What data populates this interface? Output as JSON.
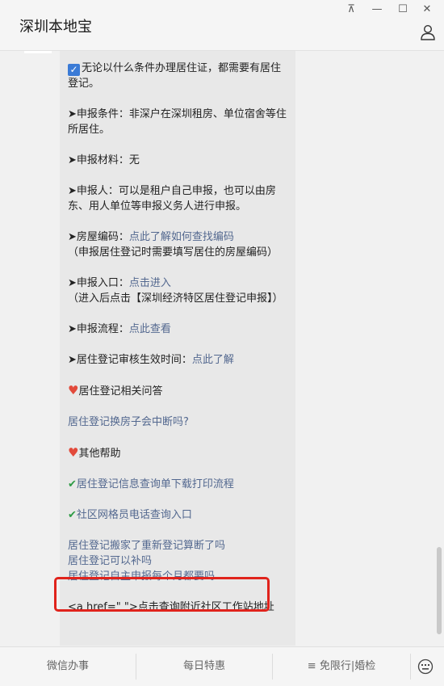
{
  "window": {
    "title": "深圳本地宝",
    "pin_glyph": "⊼",
    "minimize_glyph": "—",
    "maximize_glyph": "☐",
    "close_glyph": "✕"
  },
  "message": {
    "lines": [
      {
        "icon": "checkbox-icon",
        "text": "无论以什么条件办理居住证，都需要有居住登记。"
      },
      {
        "prefix": "➤申报条件：",
        "text": "非深户在深圳租房、单位宿舍等住所居住。"
      },
      {
        "prefix": "➤申报材料：",
        "text": "无"
      },
      {
        "prefix": "➤申报人：",
        "text": "可以是租户自己申报，也可以由房东、用人单位等申报义务人进行申报。"
      },
      {
        "prefix": "➤房屋编码：",
        "link": "点此了解如何查找编码",
        "note": "（申报居住登记时需要填写居住的房屋编码）"
      },
      {
        "prefix": "➤申报入口：",
        "link": "点击进入",
        "note": "（进入后点击【深圳经济特区居住登记申报】）"
      },
      {
        "prefix": "➤申报流程：",
        "link": "点此查看"
      },
      {
        "prefix": "➤居住登记审核生效时间：",
        "link": "点此了解"
      },
      {
        "icon": "heart-icon",
        "text": "居住登记相关问答"
      },
      {
        "link": "居住登记换房子会中断吗?"
      },
      {
        "icon": "heart-icon",
        "text": "其他帮助"
      },
      {
        "icon": "tick-icon",
        "link": "居住登记信息查询单下载打印流程"
      },
      {
        "icon": "tick-icon",
        "link": "社区网格员电话查询入口"
      },
      {
        "links": [
          "居住登记搬家了重新登记算断了吗",
          "居住登记可以补吗",
          "居住登记自主申报每个月都要吗"
        ]
      },
      {
        "text": "<a href=\" \">点击查询附近社区工作站地址"
      }
    ]
  },
  "bottom_menu": {
    "item1": "微信办事",
    "item2": "每日特惠",
    "item3": "≡ 免限行|婚检"
  },
  "colors": {
    "link": "#53688f",
    "highlight": "#e0231c",
    "bubble": "#e8e8e8"
  }
}
